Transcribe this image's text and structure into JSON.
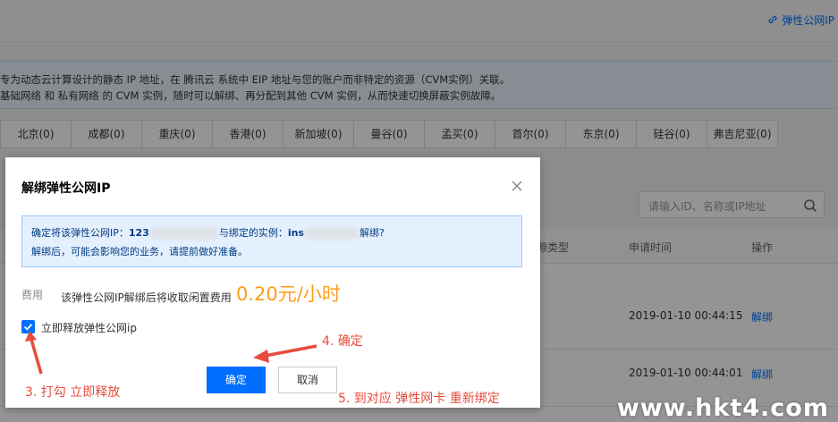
{
  "header": {
    "link_label": "弹性公网IP"
  },
  "info": {
    "line1": "专为动态云计算设计的静态 IP 地址，在 腾讯云 系统中 EIP 地址与您的账户而非特定的资源（CVM实例）关联。",
    "line2": "基础网络 和 私有网络 的 CVM 实例，随时可以解绑、再分配到其他 CVM 实例，从而快速切换屏蔽实例故障。"
  },
  "regions": [
    "北京(0)",
    "成都(0)",
    "重庆(0)",
    "香港(0)",
    "新加坡(0)",
    "曼谷(0)",
    "孟买(0)",
    "首尔(0)",
    "东京(0)",
    "硅谷(0)",
    "弗吉尼亚(0)"
  ],
  "search": {
    "placeholder": "请输入ID、名称或IP地址"
  },
  "table": {
    "headers": {
      "type": "源类型",
      "time": "申请时间",
      "action": "操作"
    },
    "rows": [
      {
        "time": "2019-01-10 00:44:15",
        "action": "解绑"
      },
      {
        "time": "2019-01-10 00:44:01",
        "action": "解绑"
      }
    ]
  },
  "dialog": {
    "title": "解绑弹性公网IP",
    "notice_prefix": "确定将该弹性公网IP：",
    "ip_partial": "123",
    "notice_mid": "与绑定的实例：",
    "instance_partial": "ins",
    "notice_suffix": "解绑?",
    "notice_line2": "解绑后，可能会影响您的业务，请提前做好准备。",
    "fee_label": "费用",
    "fee_text": "该弹性公网IP解绑后将收取闲置费用",
    "fee_price": "0.20元/小时",
    "checkbox_label": "立即释放弹性公网ip",
    "checkbox_checked": true,
    "ok_label": "确定",
    "cancel_label": "取消"
  },
  "annotations": {
    "a3": "3. 打勾 立即释放",
    "a4": "4. 确定",
    "a5": "5. 到对应 弹性网卡 重新绑定"
  },
  "watermark": "www.hkt4.com",
  "colors": {
    "primary": "#006eff",
    "price": "#ff9c19",
    "annotation": "#e74c3c"
  }
}
